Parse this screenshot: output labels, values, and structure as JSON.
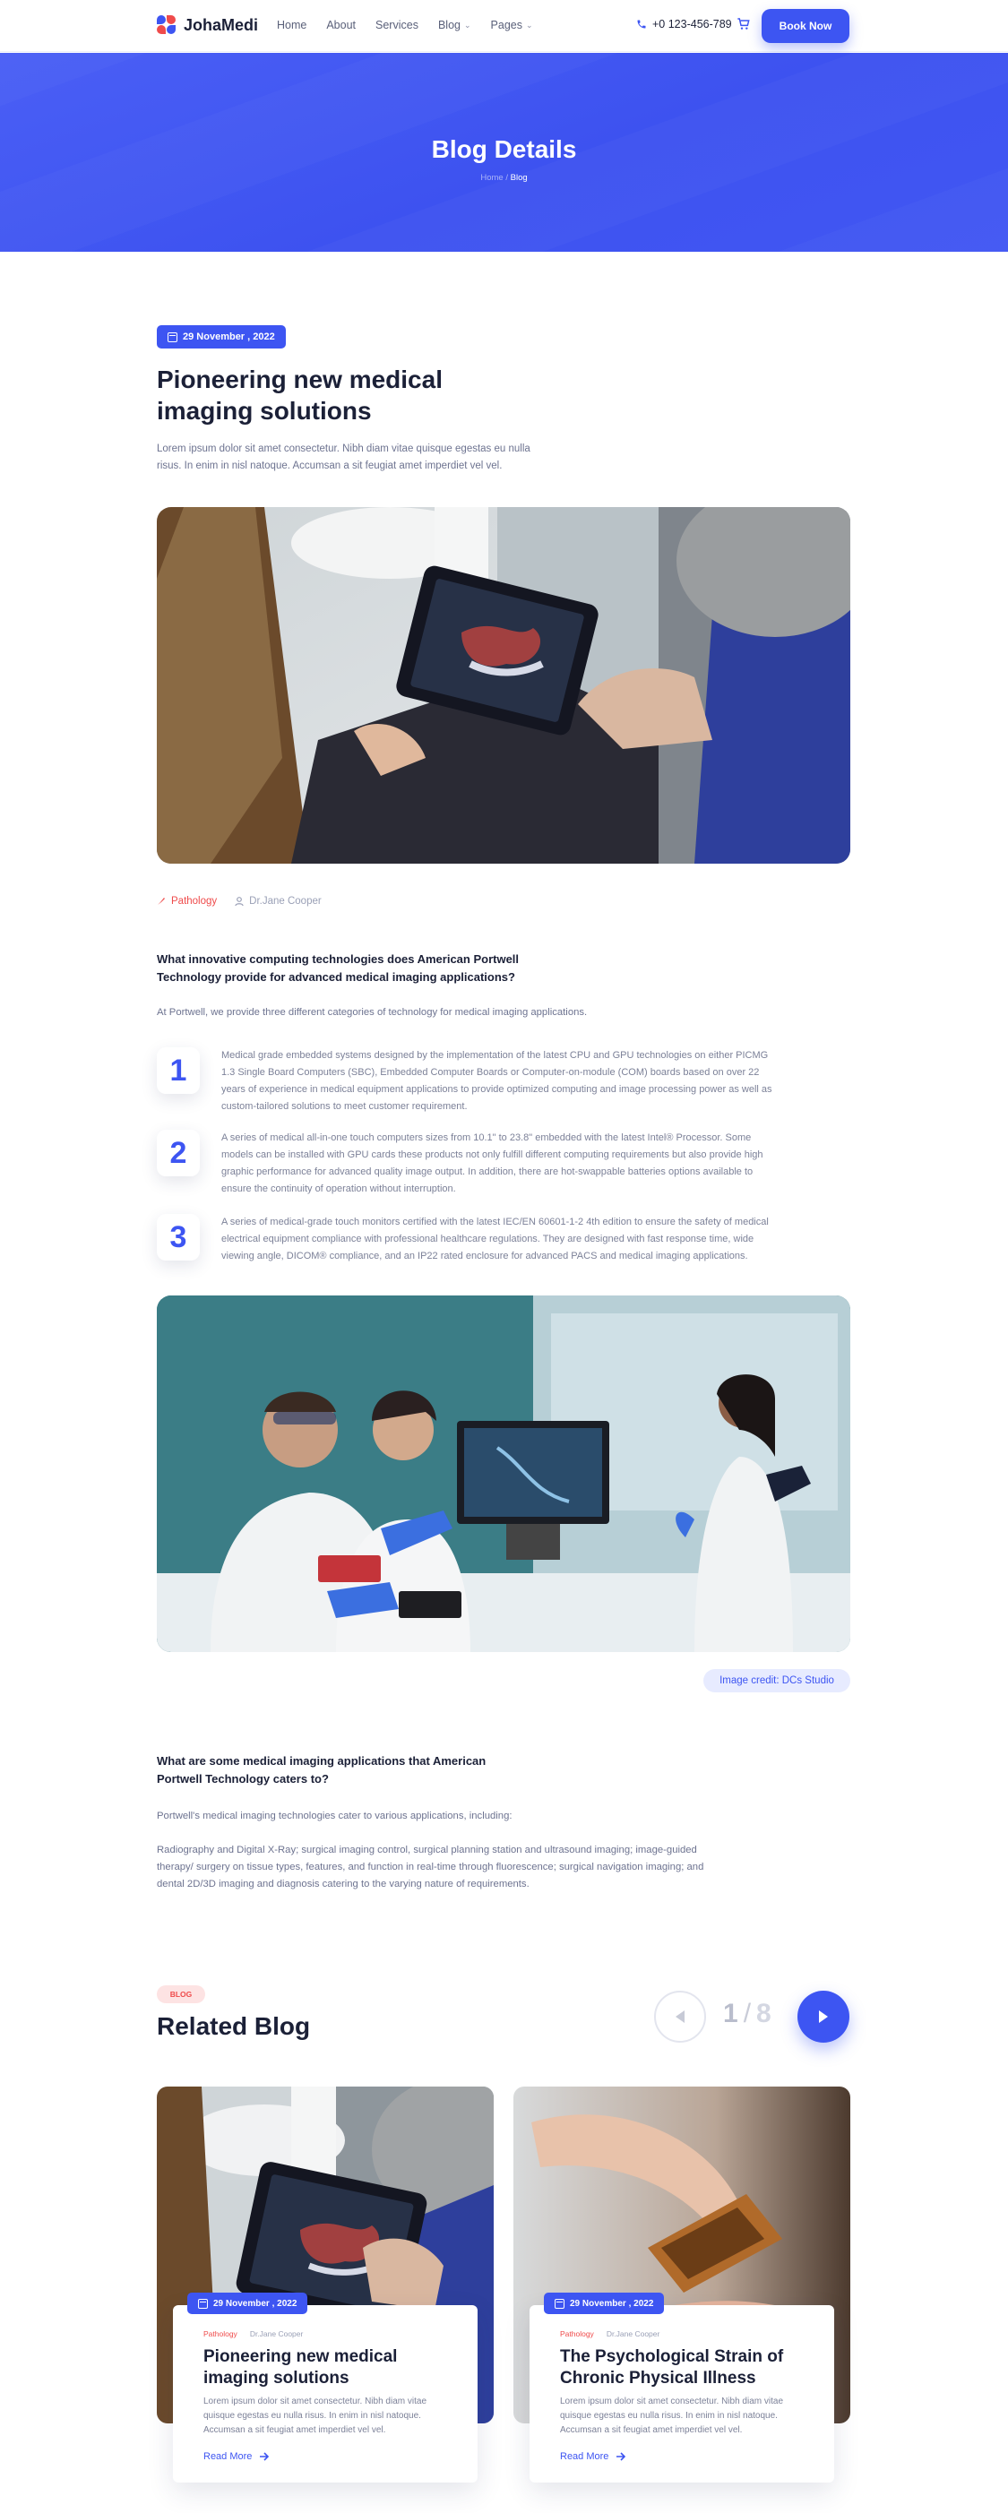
{
  "nav": {
    "brand": "JohaMedi",
    "items": [
      {
        "label": "Home"
      },
      {
        "label": "About"
      },
      {
        "label": "Services"
      },
      {
        "label": "Blog",
        "dropdown": true
      },
      {
        "label": "Pages",
        "dropdown": true
      }
    ],
    "phone": "+0 123-456-789",
    "book_label": "Book Now"
  },
  "hero": {
    "title": "Blog Details",
    "breadcrumb_home": "Home",
    "breadcrumb_sep": "/",
    "breadcrumb_current": "Blog"
  },
  "article": {
    "date": "29 November , 2022",
    "title": "Pioneering new medical imaging solutions",
    "intro": "Lorem ipsum dolor sit amet consectetur. Nibh diam vitae quisque egestas eu nulla risus. In enim in nisl natoque. Accumsan a sit feugiat amet imperdiet vel vel.",
    "category": "Pathology",
    "author": "Dr.Jane Cooper",
    "question1": "What innovative computing technologies does American Portwell Technology provide for advanced medical imaging applications?",
    "answer1": "At Portwell, we provide three different categories of technology for medical imaging applications.",
    "points": [
      {
        "n": "1",
        "text": "Medical grade embedded systems designed by the implementation of the latest CPU and GPU technologies on either PICMG 1.3 Single Board Computers (SBC), Embedded Computer Boards or Computer-on-module (COM) boards based on over 22 years of experience in medical equipment applications to provide optimized computing and image processing power as well as custom-tailored solutions to meet customer requirement."
      },
      {
        "n": "2",
        "text": "A series of medical all-in-one touch computers sizes from 10.1\" to 23.8\" embedded with the latest Intel® Processor. Some models can be installed with GPU cards these products not only fulfill different computing requirements but also provide high graphic performance for advanced quality image output. In addition, there are hot-swappable batteries options available to ensure the continuity of operation without interruption."
      },
      {
        "n": "3",
        "text": "A series of medical-grade touch monitors certified with the latest IEC/EN 60601-1-2 4th edition to ensure the safety of medical electrical equipment compliance with professional healthcare regulations. They are designed with fast response time, wide viewing angle, DICOM® compliance, and an IP22 rated enclosure for advanced PACS and medical imaging applications."
      }
    ],
    "image_credit": "Image credit: DCs Studio",
    "question2": "What are some medical imaging applications that American Portwell Technology caters to?",
    "answer2a": "Portwell's medical imaging technologies cater to various applications, including:",
    "answer2b": "Radiography and Digital X-Ray; surgical imaging control, surgical planning station and ultrasound imaging; image-guided therapy/ surgery on tissue types, features, and function in real-time through fluorescence; surgical navigation imaging; and dental 2D/3D imaging and diagnosis catering to the varying nature of requirements."
  },
  "related": {
    "tag": "BLOG",
    "title": "Related Blog",
    "page_current": "1",
    "page_sep": "/",
    "page_total": "8",
    "cards": [
      {
        "date": "29 November , 2022",
        "category": "Pathology",
        "author": "Dr.Jane Cooper",
        "title": "Pioneering new medical imaging solutions",
        "text": "Lorem ipsum dolor sit amet consectetur. Nibh diam vitae quisque egestas eu nulla risus. In enim in nisl natoque. Accumsan a sit feugiat amet imperdiet vel vel.",
        "more": "Read More"
      },
      {
        "date": "29 November , 2022",
        "category": "Pathology",
        "author": "Dr.Jane Cooper",
        "title": "The Psychological Strain of Chronic Physical Illness",
        "text": "Lorem ipsum dolor sit amet consectetur. Nibh diam vitae quisque egestas eu nulla risus. In enim in nisl natoque. Accumsan a sit feugiat amet imperdiet vel vel.",
        "more": "Read More"
      }
    ]
  },
  "colors": {
    "accent": "#3d55f2",
    "category": "#ef4b4b",
    "heading": "#1b2037"
  }
}
